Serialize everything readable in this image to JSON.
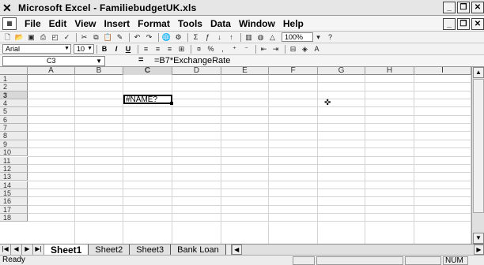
{
  "window": {
    "app_icon": "excel-x-icon",
    "title": "Microsoft Excel - FamiliebudgetUK.xls",
    "controls": [
      "_",
      "❐",
      "✕"
    ]
  },
  "menubar": {
    "items": [
      "File",
      "Edit",
      "View",
      "Insert",
      "Format",
      "Tools",
      "Data",
      "Window",
      "Help"
    ],
    "doc_controls": [
      "_",
      "❐",
      "✕"
    ]
  },
  "toolbar_standard": {
    "zoom": "100%",
    "icons": [
      "new-icon",
      "open-icon",
      "save-icon",
      "print-icon",
      "print-preview-icon",
      "spelling-icon",
      "cut-icon",
      "copy-icon",
      "paste-icon",
      "format-painter-icon",
      "undo-icon",
      "redo-icon",
      "hyperlink-icon",
      "web-toolbar-icon",
      "autosum-icon",
      "function-icon",
      "sort-ascending-icon",
      "sort-descending-icon",
      "chart-wizard-icon",
      "map-icon",
      "drawing-icon",
      "help-icon"
    ]
  },
  "toolbar_formatting": {
    "font": "Arial",
    "size": "10",
    "buttons": [
      "B",
      "I",
      "U"
    ]
  },
  "formula_bar": {
    "name_box": "C3",
    "equals": "=",
    "formula": "=B7*ExchangeRate"
  },
  "grid": {
    "columns": [
      "A",
      "B",
      "C",
      "D",
      "E",
      "F",
      "G",
      "H",
      "I"
    ],
    "rows": [
      "1",
      "2",
      "3",
      "4",
      "5",
      "6",
      "7",
      "8",
      "9",
      "10",
      "11",
      "12",
      "13",
      "14",
      "15",
      "16",
      "17",
      "18"
    ],
    "active_column": "C",
    "active_row": "3",
    "active_cell_value": "#NAME?"
  },
  "sheet_tabs": {
    "tabs": [
      "Sheet1",
      "Sheet2",
      "Sheet3",
      "Bank Loan"
    ],
    "active": "Sheet1"
  },
  "status_bar": {
    "text": "Ready",
    "num_indicator": "NUM"
  }
}
